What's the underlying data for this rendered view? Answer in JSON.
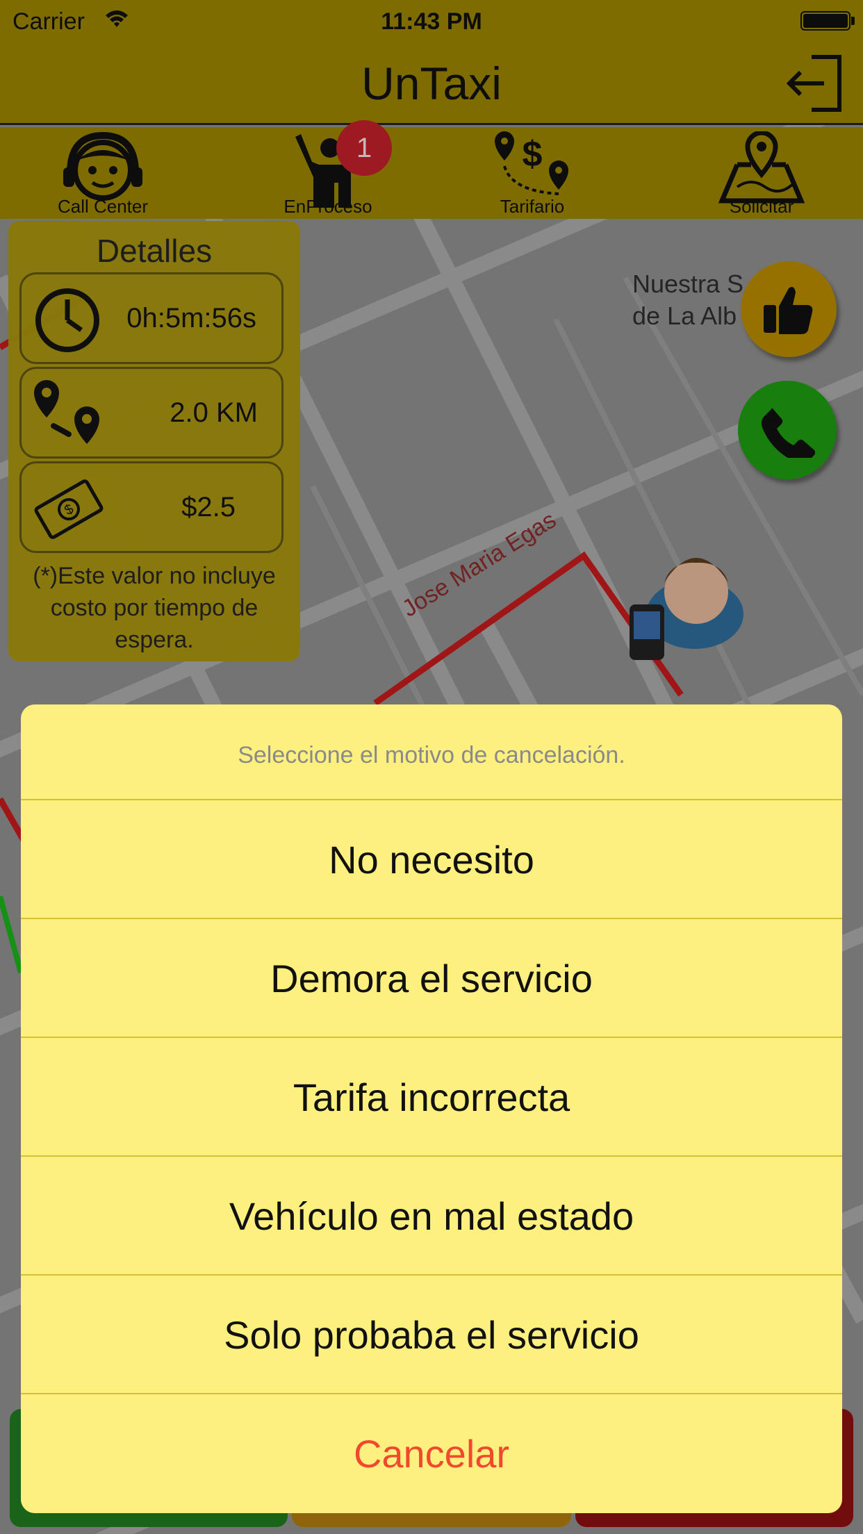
{
  "status_bar": {
    "carrier": "Carrier",
    "time": "11:43 PM",
    "wifi_icon": "wifi-icon",
    "battery_icon": "battery-icon"
  },
  "nav": {
    "title": "UnTaxi",
    "logout_icon": "logout-icon"
  },
  "tabs": [
    {
      "label": "Call Center",
      "icon": "headset-agent-icon"
    },
    {
      "label": "EnProceso",
      "icon": "hailing-person-icon",
      "badge": "1"
    },
    {
      "label": "Tarifario",
      "icon": "fare-route-icon"
    },
    {
      "label": "Solicitar",
      "icon": "map-pin-icon"
    }
  ],
  "details": {
    "title": "Detalles",
    "time": "0h:5m:56s",
    "distance": "2.0 KM",
    "price": "$2.5",
    "note": "(*)Este valor no incluye costo por tiempo de espera."
  },
  "map": {
    "place_line1": "Nuestra S",
    "place_line2": "de La Alb",
    "street": "Jose Maria Egas"
  },
  "floating": {
    "like_icon": "thumbs-up-icon",
    "call_icon": "phone-icon"
  },
  "action_sheet": {
    "title": "Seleccione el motivo de cancelación.",
    "options": [
      "No necesito",
      "Demora el servicio",
      "Tarifa incorrecta",
      "Vehículo en mal estado",
      "Solo probaba el servicio"
    ],
    "cancel": "Cancelar"
  },
  "colors": {
    "bar": "#9a8400",
    "sheet_bg": "#fdf07e",
    "cancel": "#f1482e",
    "call_green": "#1e9a12"
  }
}
